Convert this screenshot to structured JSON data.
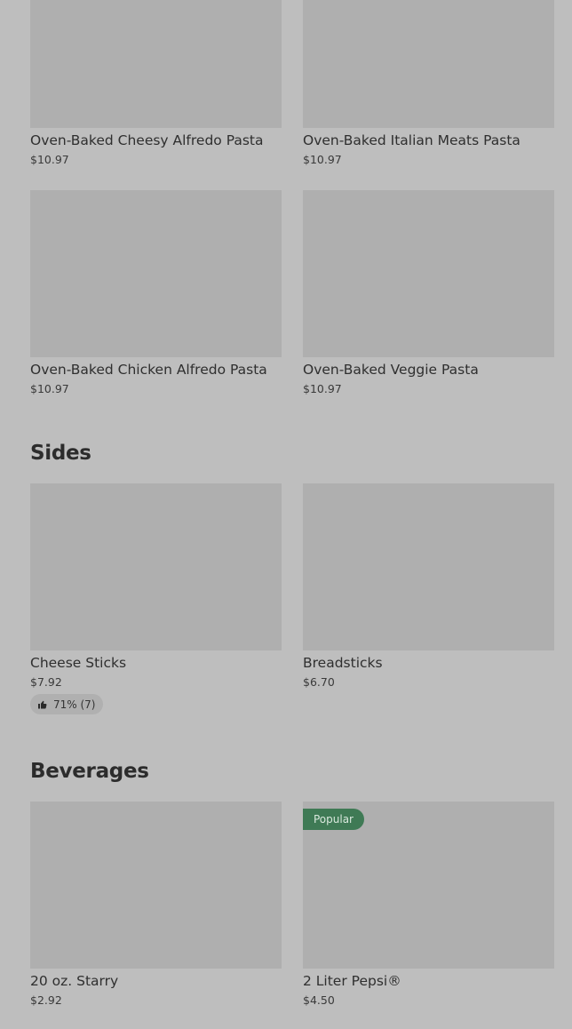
{
  "pasta": {
    "items": [
      {
        "name": "Oven-Baked Cheesy Alfredo Pasta",
        "price": "$10.97"
      },
      {
        "name": "Oven-Baked Italian Meats Pasta",
        "price": "$10.97"
      },
      {
        "name": "Oven-Baked Chicken Alfredo Pasta",
        "price": "$10.97"
      },
      {
        "name": "Oven-Baked Veggie Pasta",
        "price": "$10.97"
      }
    ]
  },
  "sides": {
    "title": "Sides",
    "items": [
      {
        "name": "Cheese Sticks",
        "price": "$7.92",
        "rating": "71% (7)"
      },
      {
        "name": "Breadsticks",
        "price": "$6.70"
      }
    ]
  },
  "beverages": {
    "title": "Beverages",
    "items": [
      {
        "name": "20 oz. Starry",
        "price": "$2.92"
      },
      {
        "name": "2 Liter Pepsi®",
        "price": "$4.50",
        "badge": "Popular"
      }
    ]
  },
  "colors": {
    "background": "#bebebe",
    "image_placeholder": "#afafaf",
    "popular_badge": "#3f7a55"
  },
  "icons": {
    "rating": "thumbs-up-icon"
  }
}
